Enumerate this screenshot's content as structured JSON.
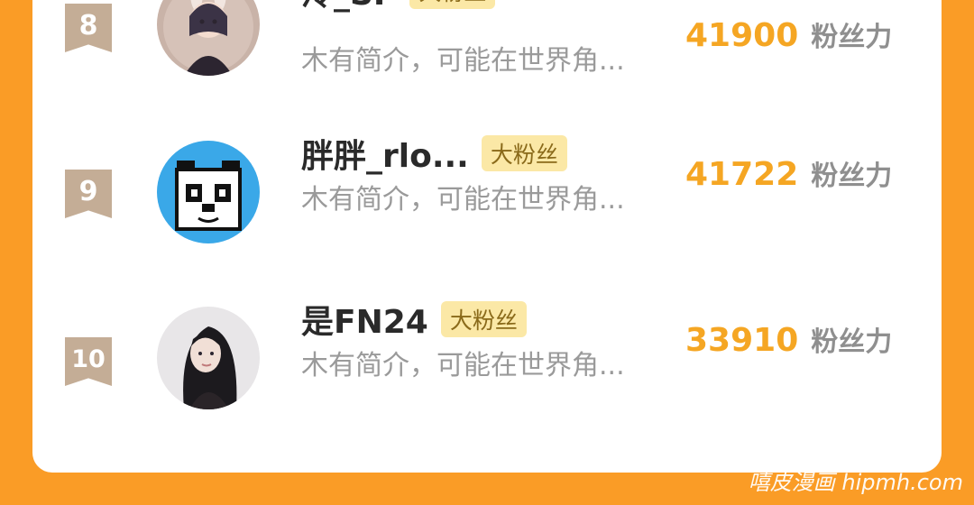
{
  "score_unit": "粉丝力",
  "fan_tag": "大粉丝",
  "rows": [
    {
      "rank": "8",
      "name": "泠_SP",
      "tag": "大粉丝",
      "intro": "木有简介，可能在世界角...",
      "score": "41900",
      "avatar_icon": "girl-with-bunny-ears-avatar"
    },
    {
      "rank": "9",
      "name": "胖胖_rlo...",
      "tag": "大粉丝",
      "intro": "木有简介，可能在世界角...",
      "score": "41722",
      "avatar_icon": "pixel-panda-avatar"
    },
    {
      "rank": "10",
      "name": "是FN24",
      "tag": "大粉丝",
      "intro": "木有简介，可能在世界角...",
      "score": "33910",
      "avatar_icon": "dark-hair-girl-photo-avatar"
    }
  ],
  "watermark": "嘻皮漫画 hipmh.com",
  "colors": {
    "background": "#fa9c26",
    "score": "#f5a623",
    "badge": "#c4ad96",
    "tag_bg": "#fbe8a6"
  }
}
